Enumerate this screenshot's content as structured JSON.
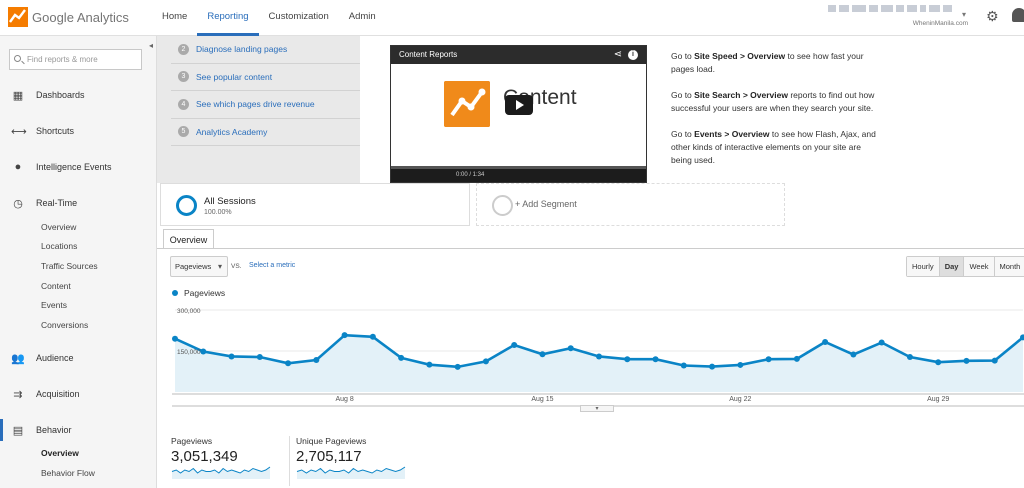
{
  "brand": {
    "name": "Google Analytics"
  },
  "nav": {
    "items": [
      "Home",
      "Reporting",
      "Customization",
      "Admin"
    ],
    "active": "Reporting"
  },
  "account": {
    "subtitle": "WheninManila.com"
  },
  "search": {
    "placeholder": "Find reports & more"
  },
  "sidebar": {
    "items": [
      {
        "label": "Dashboards",
        "icon": "dashboard-grid-icon"
      },
      {
        "label": "Shortcuts",
        "icon": "shortcut-arrows-icon"
      },
      {
        "label": "Intelligence Events",
        "icon": "lightbulb-icon"
      },
      {
        "label": "Real-Time",
        "icon": "clock-icon"
      },
      {
        "label": "Audience",
        "icon": "people-icon"
      },
      {
        "label": "Acquisition",
        "icon": "acquisition-arrows-icon"
      },
      {
        "label": "Behavior",
        "icon": "behavior-layout-icon"
      }
    ],
    "realtime_sub": [
      "Overview",
      "Locations",
      "Traffic Sources",
      "Content",
      "Events",
      "Conversions"
    ],
    "behavior_sub": [
      "Overview",
      "Behavior Flow"
    ]
  },
  "guide": {
    "links": [
      {
        "num": "2",
        "label": "Diagnose landing pages"
      },
      {
        "num": "3",
        "label": "See popular content"
      },
      {
        "num": "4",
        "label": "See which pages drive revenue"
      },
      {
        "num": "5",
        "label": "Analytics Academy"
      }
    ],
    "video": {
      "header": "Content Reports",
      "title": "Content",
      "time": "0:00 / 1:34"
    },
    "tips": [
      {
        "pre": "Go to ",
        "bold": "Site Speed > Overview",
        "post": " to see how fast your pages load."
      },
      {
        "pre": "Go to ",
        "bold": "Site Search > Overview",
        "post": " reports to find out how successful your users are when they search your site."
      },
      {
        "pre": "Go to ",
        "bold": "Events > Overview",
        "post": " to see how Flash, Ajax, and other kinds of interactive elements on your site are being used."
      }
    ]
  },
  "segments": {
    "all": {
      "title": "All Sessions",
      "sub": "100.00%"
    },
    "add": {
      "label": "+ Add Segment"
    }
  },
  "tab": {
    "label": "Overview"
  },
  "controls": {
    "metric": "Pageviews",
    "vs": "VS.",
    "select_metric": "Select a metric",
    "intervals": [
      "Hourly",
      "Day",
      "Week",
      "Month"
    ],
    "active_interval": "Day"
  },
  "chart_data": {
    "type": "area",
    "series": [
      {
        "name": "Pageviews",
        "values": [
          195000,
          148000,
          130000,
          128000,
          105000,
          117000,
          208000,
          202000,
          125000,
          100000,
          92000,
          112000,
          172000,
          138000,
          160000,
          130000,
          120000,
          120000,
          97000,
          93000,
          99000,
          120000,
          121000,
          183000,
          137000,
          181000,
          128000,
          109000,
          114000,
          115000,
          200000
        ]
      }
    ],
    "x_tick_labels": [
      "Aug 8",
      "Aug 15",
      "Aug 22",
      "Aug 29"
    ],
    "y_tick_labels": [
      "300,000",
      "150,000"
    ],
    "ylim": [
      0,
      300000
    ],
    "color": "#0a84c6",
    "fill": "#e3f1f8"
  },
  "scorecards": [
    {
      "label": "Pageviews",
      "value": "3,051,349",
      "spark": [
        5,
        6,
        4,
        6,
        5,
        7,
        4,
        6,
        5,
        5,
        6,
        4,
        7,
        5,
        6,
        5,
        4,
        6,
        5,
        7,
        6,
        5,
        6,
        8
      ]
    },
    {
      "label": "Unique Pageviews",
      "value": "2,705,117",
      "spark": [
        5,
        6,
        4,
        6,
        5,
        7,
        4,
        6,
        5,
        5,
        6,
        4,
        7,
        5,
        6,
        5,
        4,
        6,
        5,
        7,
        6,
        5,
        6,
        8
      ]
    }
  ]
}
